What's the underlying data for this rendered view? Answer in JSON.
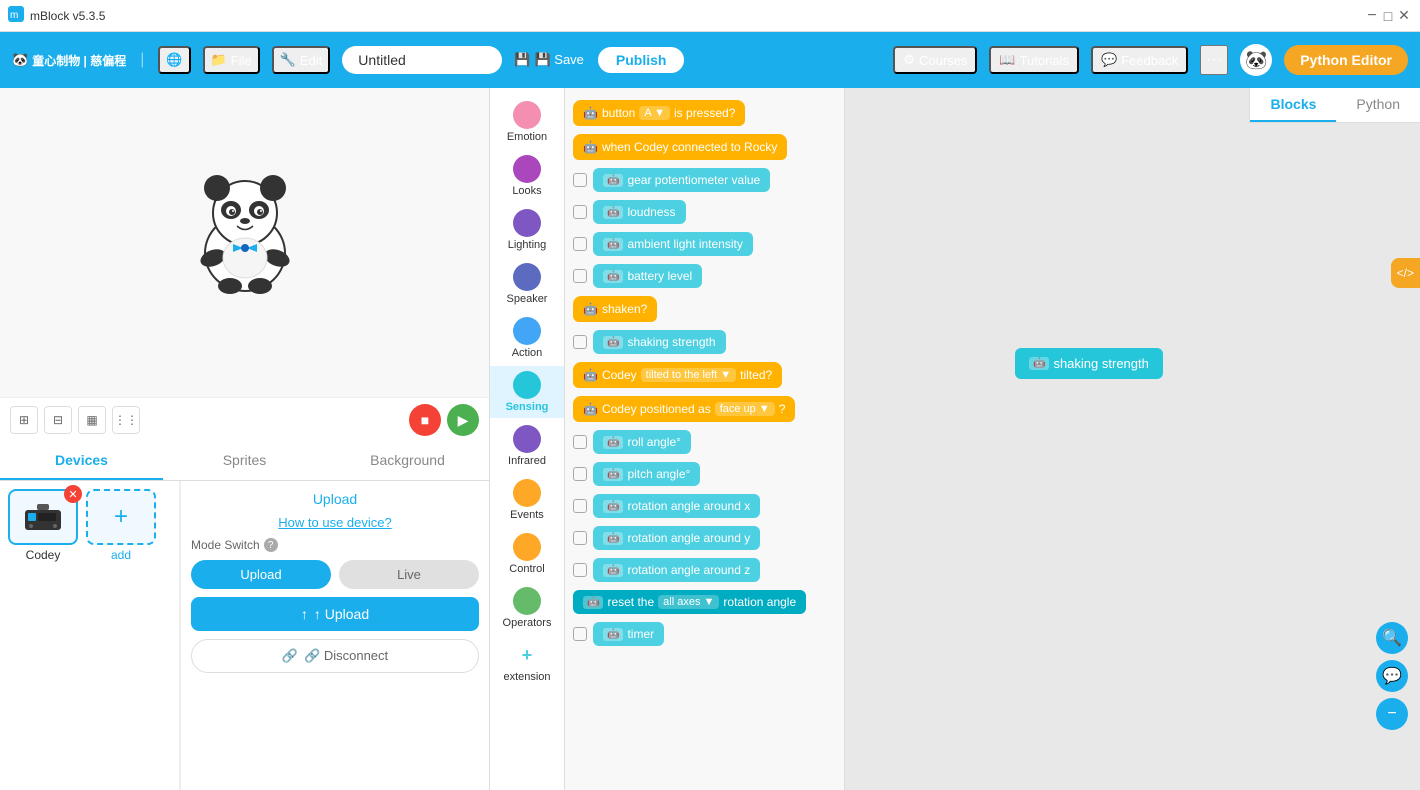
{
  "titlebar": {
    "app_name": "mBlock v5.3.5",
    "min": "−",
    "max": "□",
    "close": "✕"
  },
  "menubar": {
    "brand": "童心制物 | 慈偏程",
    "globe_icon": "🌐",
    "file_label": "File",
    "edit_label": "Edit",
    "project_name": "Untitled",
    "save_label": "💾 Save",
    "publish_label": "Publish",
    "courses_label": "Courses",
    "tutorials_label": "Tutorials",
    "feedback_label": "Feedback",
    "more_label": "···",
    "python_editor_label": "Python Editor"
  },
  "tabs": {
    "devices": "Devices",
    "sprites": "Sprites",
    "background": "Background"
  },
  "block_categories": [
    {
      "id": "emotion",
      "label": "Emotion",
      "color": "#f48fb1"
    },
    {
      "id": "looks",
      "label": "Looks",
      "color": "#ab47bc"
    },
    {
      "id": "lighting",
      "label": "Lighting",
      "color": "#7e57c2"
    },
    {
      "id": "speaker",
      "label": "Speaker",
      "color": "#5c6bc0"
    },
    {
      "id": "action",
      "label": "Action",
      "color": "#42a5f5"
    },
    {
      "id": "sensing",
      "label": "Sensing",
      "color": "#26c6da"
    },
    {
      "id": "infrared",
      "label": "Infrared",
      "color": "#7e57c2"
    },
    {
      "id": "events",
      "label": "Events",
      "color": "#ffa726"
    },
    {
      "id": "control",
      "label": "Control",
      "color": "#ffa726"
    },
    {
      "id": "operators",
      "label": "Operators",
      "color": "#66bb6a"
    },
    {
      "id": "extension",
      "label": "extension",
      "color": "#4dd0e1"
    }
  ],
  "blocks": [
    {
      "id": "btn-pressed",
      "type": "event",
      "text": "button",
      "dropdown": "A ▼",
      "suffix": "is pressed?",
      "has_checkbox": false
    },
    {
      "id": "codey-connected",
      "type": "event",
      "text": "when Codey connected to Rocky",
      "has_checkbox": false
    },
    {
      "id": "gear-potentiometer",
      "type": "sensing",
      "text": "gear potentiometer value",
      "has_checkbox": true
    },
    {
      "id": "loudness",
      "type": "sensing",
      "text": "loudness",
      "has_checkbox": true
    },
    {
      "id": "ambient-light",
      "type": "sensing",
      "text": "ambient light intensity",
      "has_checkbox": true
    },
    {
      "id": "battery-level",
      "type": "sensing",
      "text": "battery level",
      "has_checkbox": true
    },
    {
      "id": "shaken",
      "type": "event",
      "text": "shaken?",
      "has_checkbox": false
    },
    {
      "id": "shaking-strength",
      "type": "sensing",
      "text": "shaking strength",
      "has_checkbox": true
    },
    {
      "id": "codey-tilted",
      "type": "sensing",
      "text": "Codey",
      "dropdown": "tilted to the left ▼",
      "suffix": "tilted?",
      "has_checkbox": false
    },
    {
      "id": "codey-positioned",
      "type": "sensing",
      "text": "Codey positioned as",
      "dropdown": "face up ▼",
      "suffix": "?",
      "has_checkbox": false
    },
    {
      "id": "roll-angle",
      "type": "sensing",
      "text": "roll angle°",
      "has_checkbox": true
    },
    {
      "id": "pitch-angle",
      "type": "sensing",
      "text": "pitch angle°",
      "has_checkbox": true
    },
    {
      "id": "rotation-x",
      "type": "sensing",
      "text": "rotation angle around x",
      "has_checkbox": true
    },
    {
      "id": "rotation-y",
      "type": "sensing",
      "text": "rotation angle around y",
      "has_checkbox": true
    },
    {
      "id": "rotation-z",
      "type": "sensing",
      "text": "rotation angle around z",
      "has_checkbox": true
    },
    {
      "id": "reset-rotation",
      "type": "action",
      "text": "reset the",
      "dropdown": "all axes ▼",
      "suffix": "rotation angle",
      "has_checkbox": false
    },
    {
      "id": "timer",
      "type": "sensing",
      "text": "timer",
      "has_checkbox": true
    }
  ],
  "workspace": {
    "shaking_strength_label": "shaking strength"
  },
  "editor_tabs": {
    "blocks_label": "Blocks",
    "python_label": "Python"
  },
  "device": {
    "name": "Codey",
    "add_label": "add"
  },
  "upload_panel": {
    "upload_title": "Upload",
    "how_to": "How to use device?",
    "mode_switch": "Mode Switch",
    "upload_label": "Upload",
    "live_label": "Live",
    "big_upload_label": "↑ Upload",
    "disconnect_label": "🔗 Disconnect"
  },
  "stage_controls": {
    "stop_label": "■",
    "run_label": "▶"
  }
}
